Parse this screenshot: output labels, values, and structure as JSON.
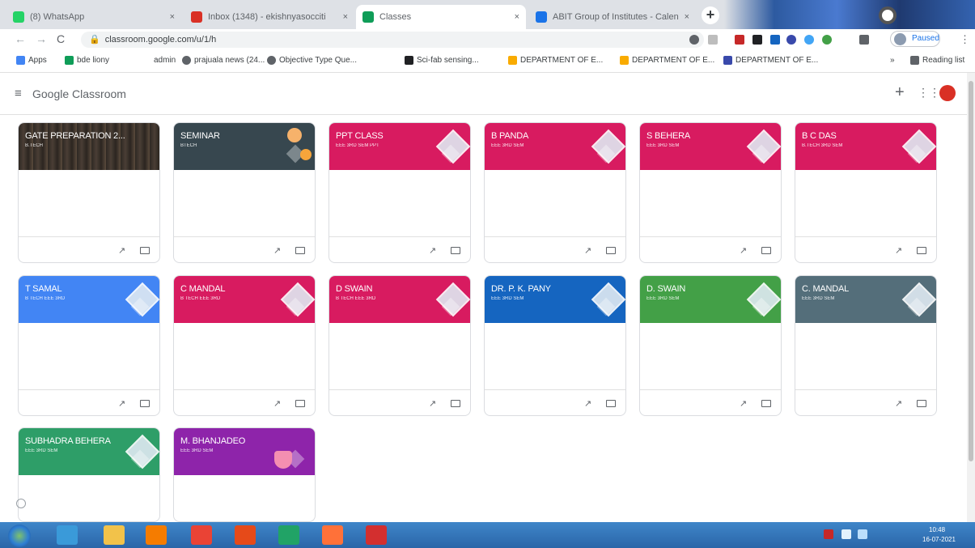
{
  "browser": {
    "tabs": [
      {
        "title": "(8) WhatsApp",
        "favicon_color": "#25d366",
        "active": false
      },
      {
        "title": "Inbox (1348) - ekishnyasocciti",
        "favicon_color": "#d93025",
        "active": false
      },
      {
        "title": "Classes",
        "favicon_color": "#0f9d58",
        "active": true
      },
      {
        "title": "ABIT Group of Institutes - Calen",
        "favicon_color": "#1a73e8",
        "active": false
      }
    ],
    "tab_close": "×",
    "new_tab": "+",
    "nav": {
      "back": "←",
      "forward": "→",
      "reload": "C"
    },
    "url": "classroom.google.com/u/1/h",
    "lock": "🔒",
    "paused_label": "Paused",
    "menu": "⋮",
    "bookmarks": [
      {
        "label": "Apps",
        "color": "#4285f4"
      },
      {
        "label": "bde liony",
        "color": "#0f9d58"
      },
      {
        "label": "admin",
        "color": "#ffffff"
      },
      {
        "label": "prajuala news (24...",
        "color": "#5f6368"
      },
      {
        "label": "Objective Type Que...",
        "color": "#5f6368"
      },
      {
        "label": "Sci-fab sensing...",
        "color": "#202124"
      },
      {
        "label": "DEPARTMENT OF E...",
        "color": "#f9ab00"
      },
      {
        "label": "DEPARTMENT OF E...",
        "color": "#f9ab00"
      },
      {
        "label": "DEPARTMENT OF E...",
        "color": "#3949ab"
      }
    ],
    "reading_list": "Reading list",
    "overflow": "»"
  },
  "classroom": {
    "menu_icon": "≡",
    "logo": "Google Classroom",
    "plus": "+",
    "apps": "⋮⋮",
    "cards": [
      {
        "title": "GATE PREPARATION 2...",
        "section": "B.TECH",
        "color": "#3a302a",
        "variant": "gate"
      },
      {
        "title": "SEMINAR",
        "section": "BTECH",
        "color": "#37474f",
        "variant": "seminar"
      },
      {
        "title": "PPT CLASS",
        "section": "EEE 3RD SEM PPT",
        "color": "#d81b60",
        "variant": "pink"
      },
      {
        "title": "B PANDA",
        "section": "EEE 3RD SEM",
        "color": "#d81b60",
        "variant": "pink"
      },
      {
        "title": "S BEHERA",
        "section": "EEE 3RD SEM",
        "color": "#d81b60",
        "variant": "pink"
      },
      {
        "title": "B C DAS",
        "section": "B.TECH 3RD SEM",
        "color": "#d81b60",
        "variant": "pink"
      },
      {
        "title": "T SAMAL",
        "section": "B TECH EEE 3RD",
        "color": "#4285f4",
        "variant": "blue"
      },
      {
        "title": "C MANDAL",
        "section": "B TECH EEE 3RD",
        "color": "#d81b60",
        "variant": "pink"
      },
      {
        "title": "D SWAIN",
        "section": "B TECH EEE 3RD",
        "color": "#d81b60",
        "variant": "pink"
      },
      {
        "title": "DR. P. K. PANY",
        "section": "EEE 3RD SEM",
        "color": "#1565c0",
        "variant": "darkblue"
      },
      {
        "title": "D. SWAIN",
        "section": "EEE 3RD SEM",
        "color": "#43a047",
        "variant": "green"
      },
      {
        "title": "C. MANDAL",
        "section": "EEE 3RD SEM",
        "color": "#546e7a",
        "variant": "slate"
      },
      {
        "title": "SUBHADRA BEHERA",
        "section": "EEE 3RD SEM",
        "color": "#2e9e68",
        "variant": "green"
      },
      {
        "title": "M. BHANJADEO",
        "section": "EEE 3RD SEM",
        "color": "#8e24aa",
        "variant": "purple"
      }
    ],
    "trend_icon": "↗",
    "help": "?"
  },
  "taskbar": {
    "apps": [
      {
        "name": "internet-explorer",
        "color": "#3a9ad9"
      },
      {
        "name": "file-explorer",
        "color": "#f2c24a"
      },
      {
        "name": "media-player",
        "color": "#f57c00"
      },
      {
        "name": "chrome",
        "color": "#ea4335"
      },
      {
        "name": "qbittorrent",
        "color": "#e64a19"
      },
      {
        "name": "excel",
        "color": "#21a366"
      },
      {
        "name": "firefox",
        "color": "#ff7139"
      },
      {
        "name": "acrobat",
        "color": "#d32f2f"
      }
    ],
    "time": "10:48",
    "date": "16-07-2021"
  }
}
